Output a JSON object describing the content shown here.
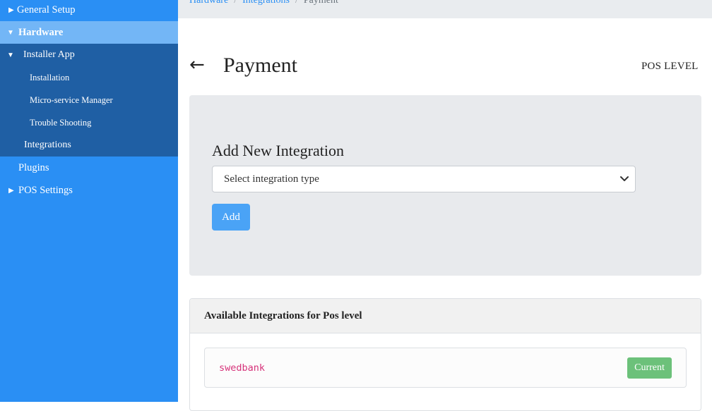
{
  "sidebar": {
    "items": [
      {
        "label": "General Setup",
        "expander": "▶"
      },
      {
        "label": "Hardware",
        "expander": "▼"
      },
      {
        "label": "Installer App",
        "expander": "▼"
      },
      {
        "label": "Installation"
      },
      {
        "label": "Micro-service Manager"
      },
      {
        "label": "Trouble Shooting"
      },
      {
        "label": "Integrations"
      },
      {
        "label": "Plugins"
      },
      {
        "label": "POS Settings",
        "expander": "▶"
      }
    ]
  },
  "breadcrumb": {
    "items": [
      "Hardware",
      "Integrations",
      "Payment"
    ],
    "separator": "/"
  },
  "header": {
    "back_icon": "←",
    "title": "Payment",
    "level": "POS LEVEL"
  },
  "add_panel": {
    "title": "Add New Integration",
    "select_placeholder": "Select integration type",
    "add_label": "Add"
  },
  "available": {
    "title": "Available Integrations for Pos level",
    "integrations": [
      {
        "name": "swedbank",
        "status": "Current"
      }
    ]
  },
  "colors": {
    "sidebar_bg": "#2a8ff4",
    "sidebar_active": "#73b6f6",
    "sidebar_sub": "#1f5fa4",
    "link": "#2a8ff4",
    "add_button": "#4aa3f6",
    "badge_success": "#6cc17a",
    "code_pink": "#d6337a"
  }
}
